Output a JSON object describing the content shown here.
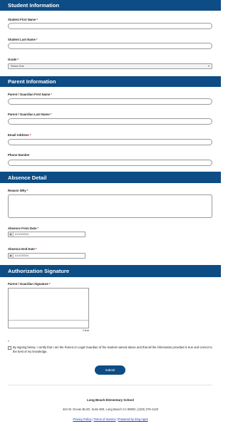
{
  "sections": {
    "student": "Student Information",
    "parent": "Parent Information",
    "absence": "Absence Detail",
    "authorization": "Authorization Signature"
  },
  "fields": {
    "student_first": "Student First Name",
    "student_last": "Student Last Name",
    "grade": "Grade",
    "grade_value": "Select One",
    "guardian_first": "Parent / Guardian First Name",
    "guardian_last": "Parent / Guardian Last Name",
    "email": "Email Address",
    "phone": "Phone Number",
    "reason": "Reason Why",
    "absence_from": "Absence From Date",
    "absence_from_value": "01/10/2024",
    "absence_end": "Absence End Date",
    "absence_end_value": "01/10/2024",
    "signature": "Parent / Guardian Signature",
    "clear": "Clear"
  },
  "required_mark": "*",
  "certification": "By signing below, I certify that I am the Parent or Legal Guardian of the student named above and that all the information provided is true and correct to the best of my knowledge.",
  "submit": "Submit",
  "footer": {
    "school": "Long Beach Elementary School",
    "address": "444 W. Ocean BLVD. Suite 600, Long Beach CA 90802 | (323) 375-1120",
    "link_privacy": "Privacy Policy",
    "link_terms": "Terms of Service",
    "link_powered": "Powered by Zing Apps",
    "separator": "|"
  },
  "icons": {
    "calendar": "calendar-icon",
    "select_arrow": "chevron-down-icon"
  },
  "colors": {
    "header": "#0d4c84",
    "required": "#d11a1a",
    "link": "#1a3dbf"
  }
}
